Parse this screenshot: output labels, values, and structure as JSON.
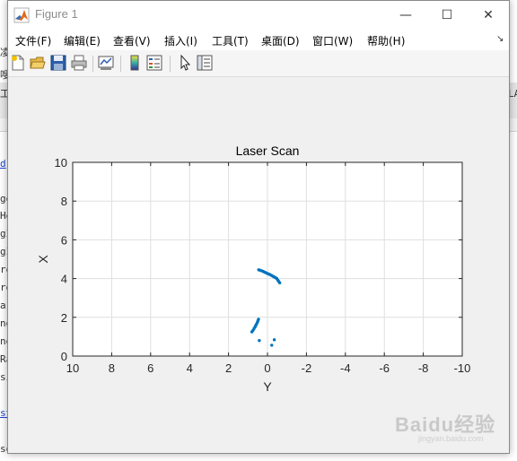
{
  "background_editor": {
    "fragments": [
      {
        "text": "凌",
        "top": 52,
        "link": false
      },
      {
        "text": "嗖",
        "top": 77,
        "link": false
      },
      {
        "text": "工",
        "top": 98,
        "link": false
      },
      {
        "text": "d",
        "top": 176,
        "link": true
      },
      {
        "text": "ge",
        "top": 215,
        "link": false
      },
      {
        "text": "He",
        "top": 234,
        "link": false
      },
      {
        "text": "gI",
        "top": 254,
        "link": false
      },
      {
        "text": "gI",
        "top": 274,
        "link": false
      },
      {
        "text": "re",
        "top": 294,
        "link": false
      },
      {
        "text": "re",
        "top": 314,
        "link": false
      },
      {
        "text": "ar",
        "top": 334,
        "link": false
      },
      {
        "text": "ng",
        "top": 354,
        "link": false
      },
      {
        "text": "ng",
        "top": 374,
        "link": false
      },
      {
        "text": "Ra",
        "top": 394,
        "link": false
      },
      {
        "text": "si",
        "top": 414,
        "link": false
      },
      {
        "text": "st",
        "top": 454,
        "link": true
      },
      {
        "text": "so",
        "top": 494,
        "link": false
      }
    ],
    "right_fragment": "LA"
  },
  "window": {
    "title": "Figure 1",
    "min_glyph": "—",
    "max_glyph": "☐",
    "close_glyph": "✕"
  },
  "menus": [
    {
      "label": "文件(F)"
    },
    {
      "label": "编辑(E)"
    },
    {
      "label": "查看(V)"
    },
    {
      "label": "插入(I)"
    },
    {
      "label": "工具(T)"
    },
    {
      "label": "桌面(D)"
    },
    {
      "label": "窗口(W)"
    },
    {
      "label": "帮助(H)"
    }
  ],
  "menu_overflow_glyph": "↘",
  "toolbar": [
    {
      "name": "new-figure-icon"
    },
    {
      "name": "open-file-icon"
    },
    {
      "name": "save-icon"
    },
    {
      "name": "print-icon"
    },
    {
      "name": "link-plot-icon"
    },
    {
      "name": "colorbar-icon"
    },
    {
      "name": "legend-icon"
    },
    {
      "name": "pointer-icon"
    },
    {
      "name": "property-editor-icon"
    }
  ],
  "colors": {
    "marker": "#0072bd",
    "grid": "#dfdfdf",
    "axis": "#262626"
  },
  "chart_data": {
    "type": "scatter",
    "title": "Laser Scan",
    "xlabel": "Y",
    "ylabel": "X",
    "xlim": [
      10,
      -10
    ],
    "ylim": [
      0,
      10
    ],
    "x_reversed": true,
    "grid": true,
    "xticks": [
      10,
      8,
      6,
      4,
      2,
      0,
      -2,
      -4,
      -6,
      -8,
      -10
    ],
    "yticks": [
      0,
      2,
      4,
      6,
      8,
      10
    ],
    "points": [
      [
        0.45,
        4.45
      ],
      [
        0.38,
        4.43
      ],
      [
        0.3,
        4.4
      ],
      [
        0.22,
        4.37
      ],
      [
        0.15,
        4.33
      ],
      [
        0.08,
        4.3
      ],
      [
        0.0,
        4.26
      ],
      [
        -0.07,
        4.23
      ],
      [
        -0.14,
        4.2
      ],
      [
        -0.21,
        4.16
      ],
      [
        -0.28,
        4.12
      ],
      [
        -0.35,
        4.08
      ],
      [
        -0.42,
        4.04
      ],
      [
        -0.48,
        4.0
      ],
      [
        -0.53,
        3.92
      ],
      [
        -0.58,
        3.85
      ],
      [
        -0.63,
        3.78
      ],
      [
        0.8,
        1.25
      ],
      [
        0.74,
        1.33
      ],
      [
        0.69,
        1.42
      ],
      [
        0.64,
        1.5
      ],
      [
        0.6,
        1.58
      ],
      [
        0.56,
        1.66
      ],
      [
        0.52,
        1.74
      ],
      [
        0.49,
        1.82
      ],
      [
        0.46,
        1.9
      ],
      [
        0.42,
        0.8
      ],
      [
        -0.35,
        0.84
      ],
      [
        -0.22,
        0.56
      ]
    ]
  },
  "watermark": {
    "text": "Baidu经验",
    "sub": "jingyan.baidu.com"
  }
}
